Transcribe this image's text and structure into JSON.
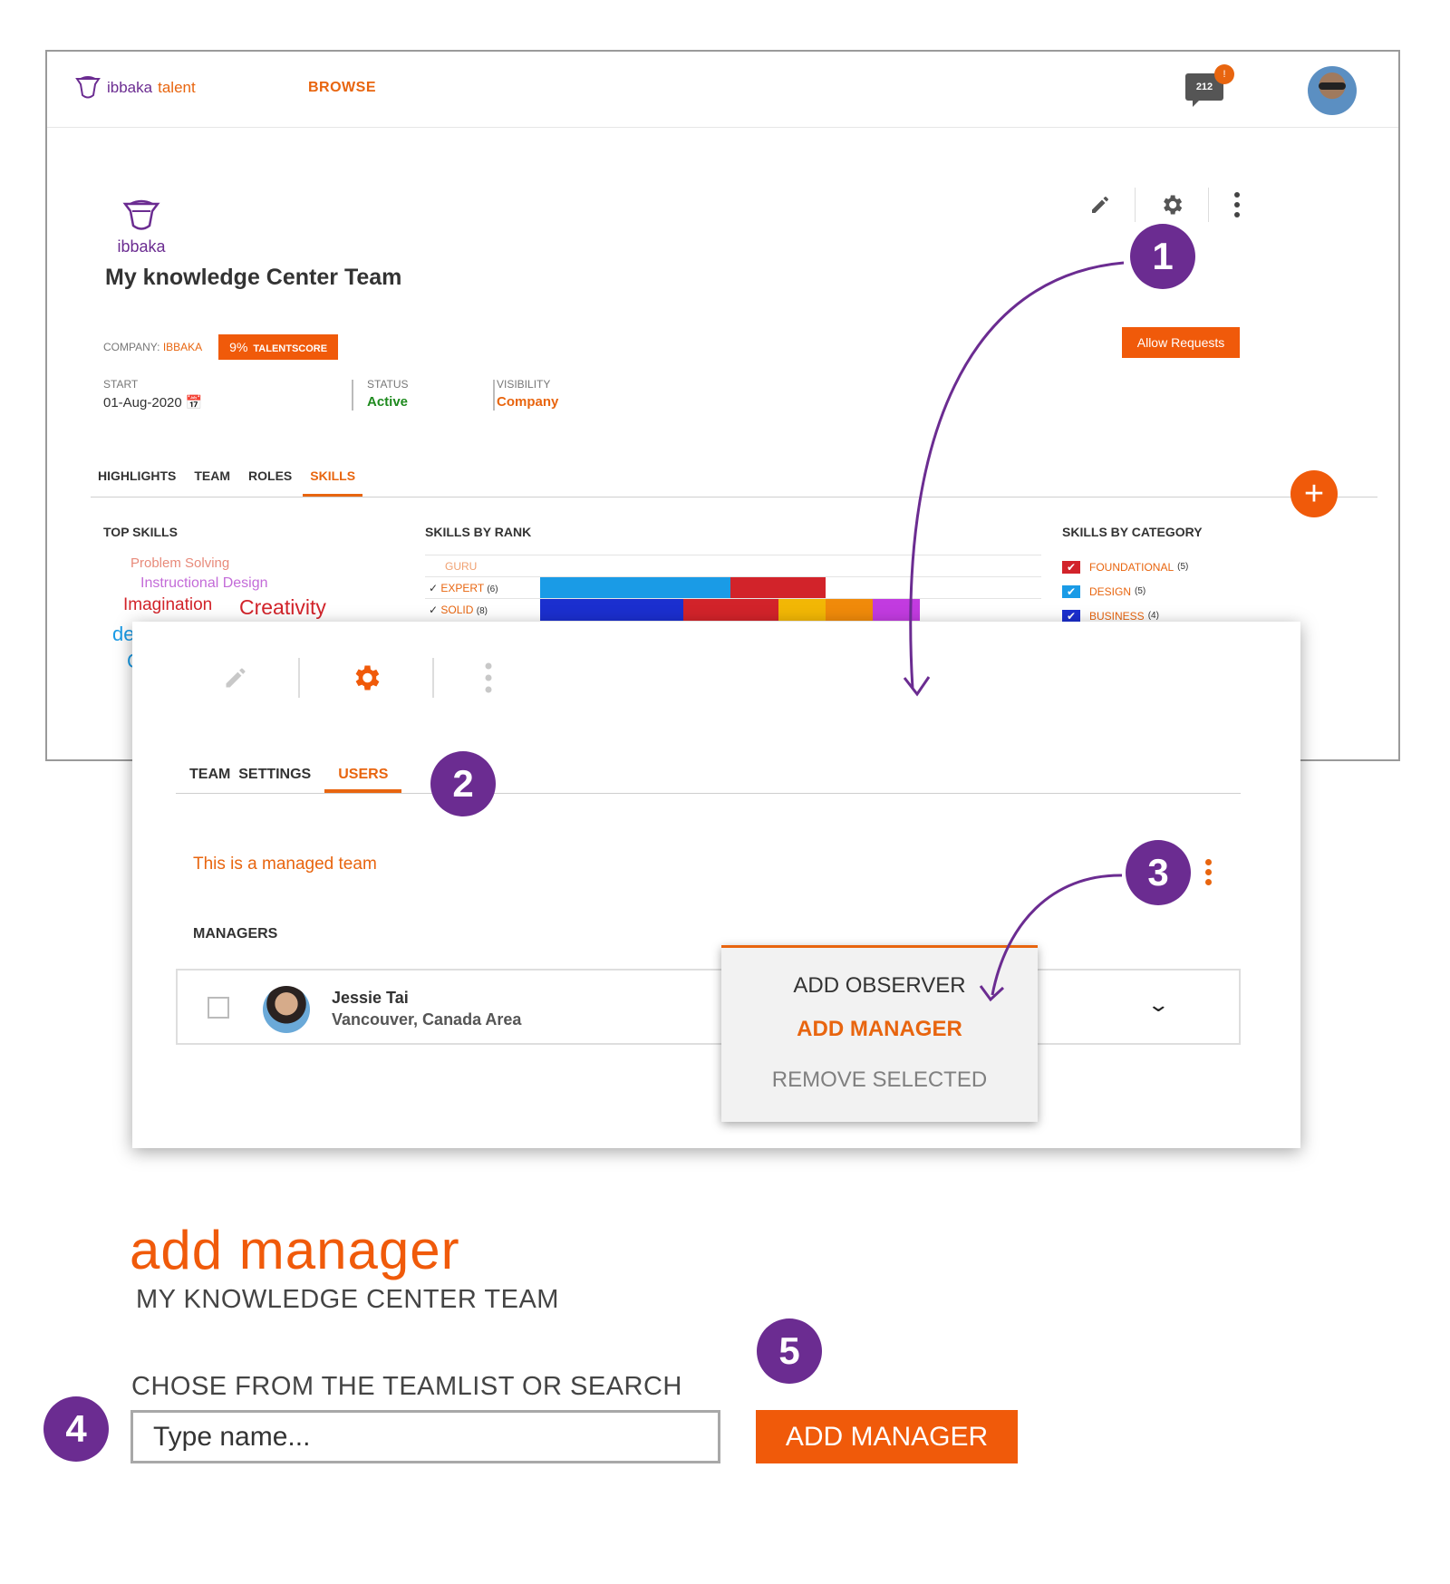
{
  "header": {
    "brand_name": "ibbaka",
    "brand_product": "talent",
    "nav_browse": "BROWSE",
    "notification_count": "212",
    "notification_badge": "!"
  },
  "team": {
    "logo_text": "ibbaka",
    "title": "My knowledge Center Team",
    "company_label": "COMPANY:",
    "company_value": "IBBAKA",
    "talentscore_value": "9%",
    "talentscore_label": "TALENTSCORE",
    "allow_requests": "Allow Requests",
    "start_label": "START",
    "start_value": "01-Aug-2020",
    "status_label": "STATUS",
    "status_value": "Active",
    "visibility_label": "VISIBILITY",
    "visibility_value": "Company",
    "tabs": [
      "HIGHLIGHTS",
      "TEAM",
      "ROLES",
      "SKILLS"
    ],
    "active_tab": "SKILLS"
  },
  "skills": {
    "top_skills_head": "TOP SKILLS",
    "by_rank_head": "SKILLS BY RANK",
    "by_category_head": "SKILLS BY CATEGORY",
    "cloud": [
      "Problem Solving",
      "Instructional Design",
      "Imagination",
      "Creativity",
      "de",
      "C"
    ],
    "rank_rows": [
      {
        "label": "GURU",
        "count": "",
        "check": ""
      },
      {
        "label": "EXPERT",
        "count": "(6)",
        "check": "✓"
      },
      {
        "label": "SOLID",
        "count": "(8)",
        "check": "✓"
      }
    ],
    "categories": [
      {
        "label": "FOUNDATIONAL",
        "count": "(5)",
        "color": "#d2232a"
      },
      {
        "label": "DESIGN",
        "count": "(5)",
        "color": "#1a9be6"
      },
      {
        "label": "BUSINESS",
        "count": "(4)",
        "color": "#1b2fcf"
      }
    ]
  },
  "overlay": {
    "tabs": [
      "TEAM  SETTINGS",
      "USERS"
    ],
    "active_tab": "USERS",
    "managed_text": "This is a managed team",
    "managers_head": "MANAGERS",
    "manager": {
      "name": "Jessie Tai",
      "location": "Vancouver, Canada Area"
    },
    "menu": [
      "ADD OBSERVER",
      "ADD MANAGER",
      "REMOVE SELECTED"
    ]
  },
  "add_manager": {
    "title": "add manager",
    "subtitle": "MY KNOWLEDGE CENTER TEAM",
    "instruction": "CHOSE FROM THE TEAMLIST OR SEARCH",
    "input_placeholder": "Type name...",
    "button_label": "ADD MANAGER"
  },
  "steps": [
    "1",
    "2",
    "3",
    "4",
    "5"
  ],
  "colors": {
    "accent_orange": "#f05a0a",
    "brand_purple": "#6b2c91",
    "status_green": "#1e8a1e"
  }
}
